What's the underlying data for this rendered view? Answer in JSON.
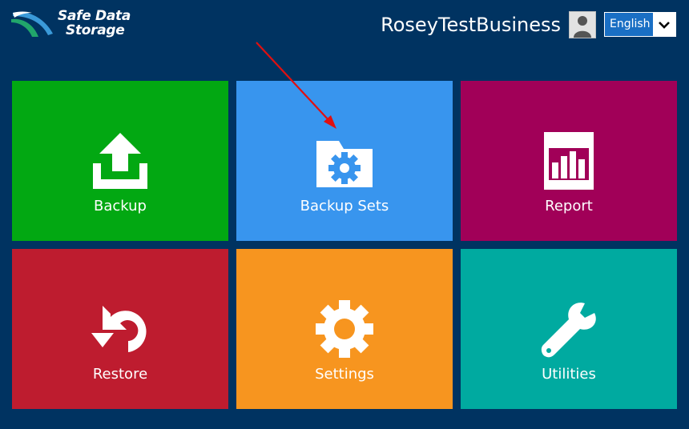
{
  "header": {
    "logo_line1": "Safe Data",
    "logo_line2": "Storage",
    "username": "RoseyTestBusiness",
    "language": {
      "selected": "English"
    }
  },
  "tiles": [
    {
      "label": "Backup",
      "icon": "upload-icon",
      "color": "#02a812"
    },
    {
      "label": "Backup Sets",
      "icon": "folder-gear-icon",
      "color": "#3895ee"
    },
    {
      "label": "Report",
      "icon": "bar-chart-icon",
      "color": "#a10058"
    },
    {
      "label": "Restore",
      "icon": "restore-icon",
      "color": "#be1c2f"
    },
    {
      "label": "Settings",
      "icon": "gear-icon",
      "color": "#f7951f"
    },
    {
      "label": "Utilities",
      "icon": "wrench-icon",
      "color": "#00aaa0"
    }
  ],
  "colors": {
    "background": "#003361",
    "annotation_arrow": "#e01010"
  }
}
